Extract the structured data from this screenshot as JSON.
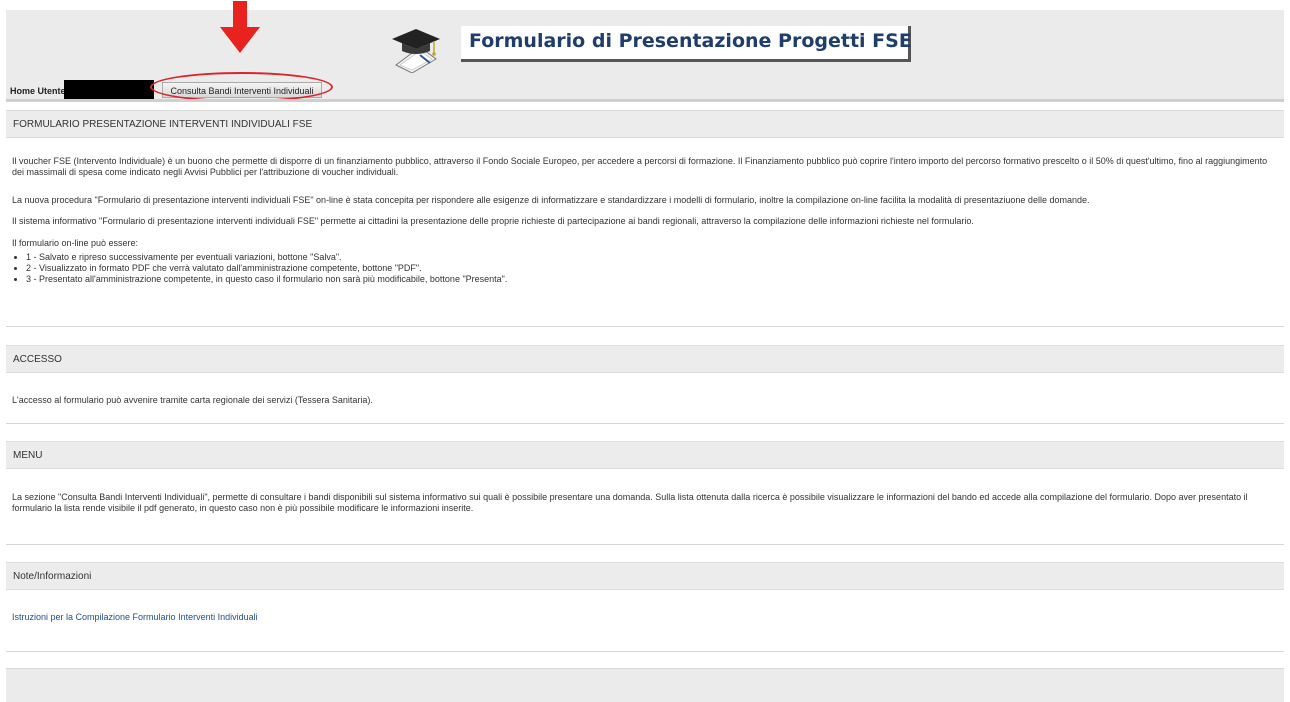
{
  "header": {
    "title": "Formulario di Presentazione Progetti FSE",
    "logo_icon": "graduation-cap-diploma-icon",
    "annotation_icon": "red-arrow-down-icon",
    "accent_color": "#1f3e6b",
    "annotation_color": "#d9262b"
  },
  "home_row": {
    "label": "Home Utente:",
    "consulta_button_label": "Consulta Bandi Interventi Individuali"
  },
  "sections": {
    "formulario": {
      "title": "FORMULARIO PRESENTAZIONE INTERVENTI INDIVIDUALI FSE",
      "paragraphs": [
        "Il voucher FSE (Intervento Individuale) è un buono che permette di disporre di un finanziamento pubblico, attraverso il Fondo Sociale Europeo, per accedere a percorsi di formazione. Il Finanziamento pubblico può coprire l'intero importo del percorso formativo prescelto o il 50% di quest'ultimo, fino al raggiungimento dei massimali di spesa come indicato negli Avvisi Pubblici per l'attribuzione di voucher individuali.",
        "La nuova procedura \"Formulario di presentazione interventi individuali FSE\" on-line è stata concepita per rispondere alle esigenze di informatizzare e standardizzare i modelli di formulario, inoltre la compilazione on-line facilita la modalità di presentaziuone delle domande.",
        "Il sistema informativo \"Formulario di presentazione interventi individuali FSE\" permette ai cittadini la presentazione delle proprie richieste di partecipazione ai bandi regionali, attraverso la compilazione delle informazioni richieste nel formulario.",
        "Il formulario on-line può essere:"
      ],
      "list": [
        "1 - Salvato e ripreso successivamente per eventuali variazioni, bottone \"Salva\".",
        "2 - Visualizzato in formato PDF che verrà valutato dall'amministrazione competente, bottone \"PDF\".",
        "3 - Presentato all'amministrazione competente, in questo caso il formulario non sarà più modificabile, bottone \"Presenta\"."
      ]
    },
    "accesso": {
      "title": "ACCESSO",
      "text": "L'accesso al formulario può avvenire tramite carta regionale dei servizi (Tessera Sanitaria)."
    },
    "menu": {
      "title": "MENU",
      "text": "La sezione \"Consulta Bandi Interventi Individuali\", permette di consultare i bandi disponibili sul sistema informativo sui quali è possibile presentare una domanda. Sulla lista ottenuta dalla ricerca è possibile visualizzare le informazioni del bando ed accede alla compilazione del formulario. Dopo aver presentato il formulario la lista rende visibile il pdf generato, in questo caso non è più possibile modificare le informazioni inserite."
    },
    "note": {
      "title": "Note/Informazioni",
      "link_label": "Istruzioni per la Compilazione Formulario Interventi Individuali"
    }
  }
}
